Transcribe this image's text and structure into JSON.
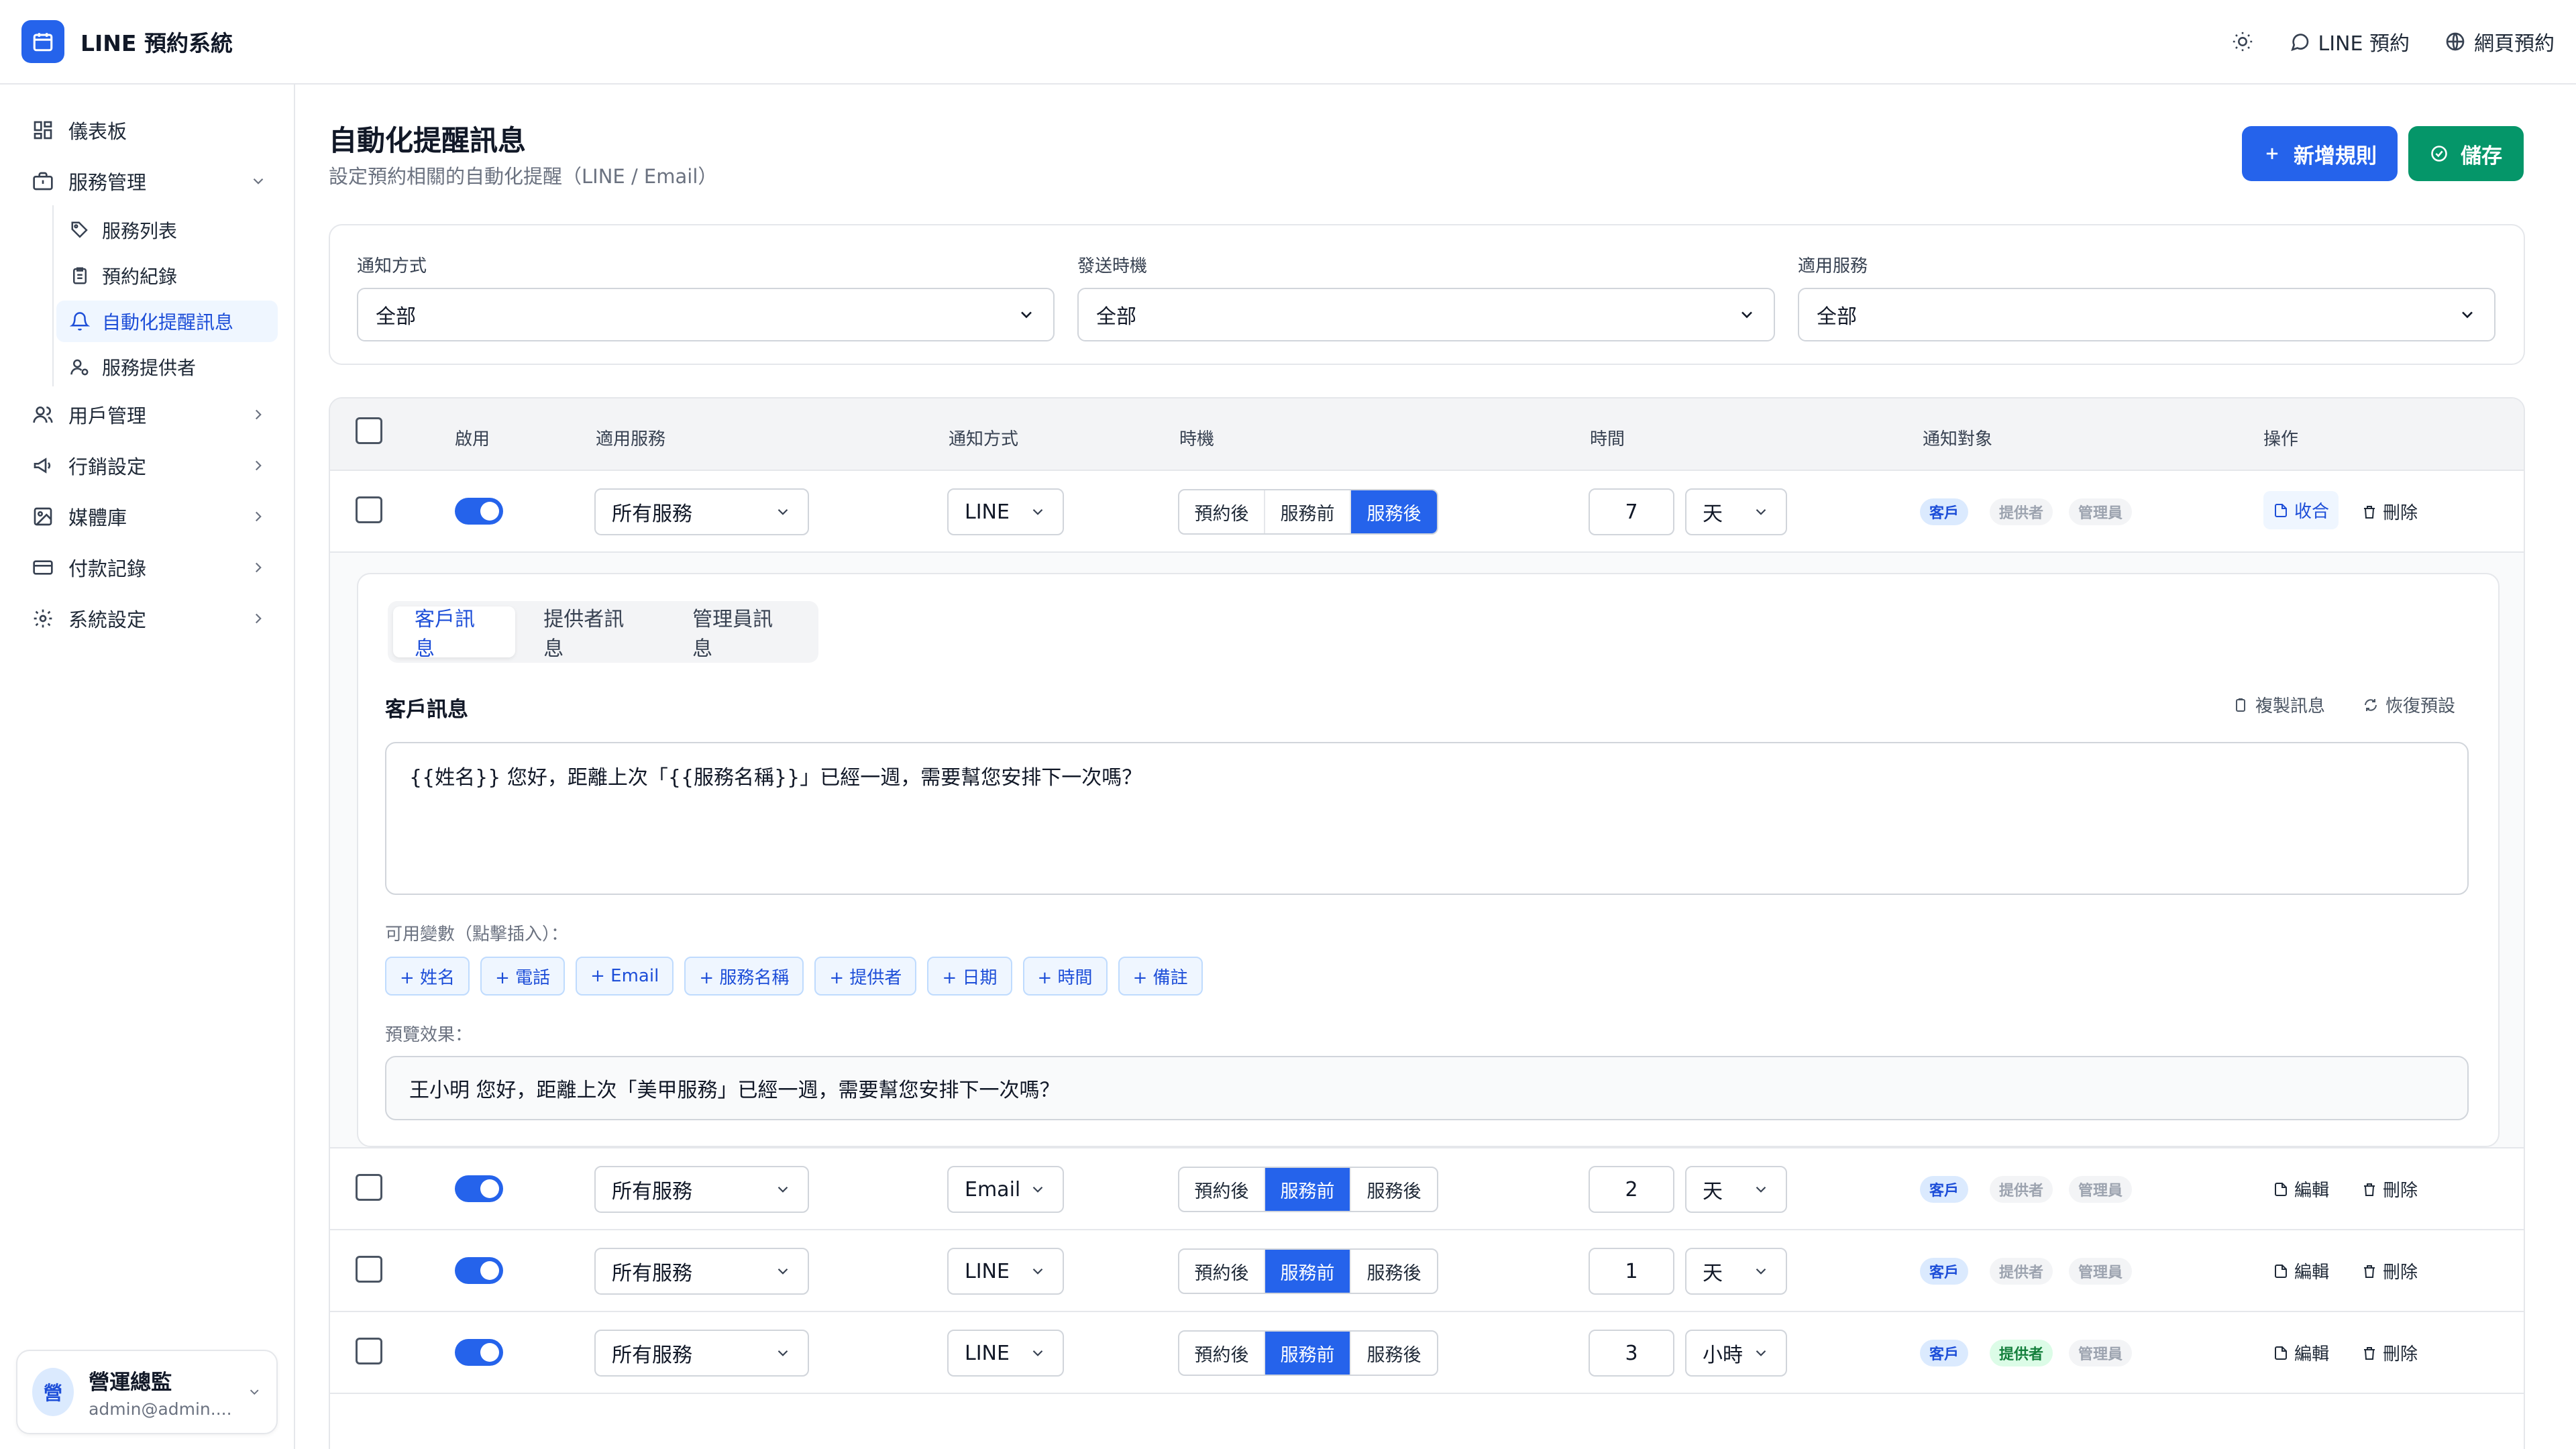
{
  "app": {
    "title": "LINE 預約系統"
  },
  "topbar": {
    "theme_icon": "sun-icon",
    "line_link": "LINE 預約",
    "web_link": "網頁預約"
  },
  "sidebar": {
    "dashboard": "儀表板",
    "service_mgmt": "服務管理",
    "sub": [
      "服務列表",
      "預約紀錄",
      "自動化提醒訊息",
      "服務提供者"
    ],
    "user_mgmt": "用戶管理",
    "marketing": "行銷設定",
    "media": "媒體庫",
    "payments": "付款記錄",
    "settings": "系統設定",
    "user": {
      "initial": "營",
      "name": "營運總監",
      "email": "admin@admin...."
    }
  },
  "page": {
    "title": "自動化提醒訊息",
    "subtitle": "設定預約相關的自動化提醒（LINE / Email）",
    "add_button": "新增規則",
    "save_button": "儲存"
  },
  "filters": {
    "method": {
      "label": "通知方式",
      "value": "全部"
    },
    "timing": {
      "label": "發送時機",
      "value": "全部"
    },
    "service": {
      "label": "適用服務",
      "value": "全部"
    }
  },
  "table": {
    "headers": {
      "enabled": "啟用",
      "service": "適用服務",
      "method": "通知方式",
      "timing": "時機",
      "time": "時間",
      "target": "通知對象",
      "actions": "操作"
    },
    "timing_options": [
      "預約後",
      "服務前",
      "服務後"
    ],
    "target_labels": [
      "客戶",
      "提供者",
      "管理員"
    ],
    "rows": [
      {
        "service": "所有服務",
        "method": "LINE",
        "timing": 2,
        "amount": "7",
        "unit": "天",
        "targets": [
          "on",
          "off",
          "off"
        ],
        "action": "收合",
        "delete": "刪除"
      },
      {
        "service": "所有服務",
        "method": "Email",
        "timing": 1,
        "amount": "2",
        "unit": "天",
        "targets": [
          "on",
          "off",
          "off"
        ],
        "action": "編輯",
        "delete": "刪除"
      },
      {
        "service": "所有服務",
        "method": "LINE",
        "timing": 1,
        "amount": "1",
        "unit": "天",
        "targets": [
          "on",
          "off",
          "off"
        ],
        "action": "編輯",
        "delete": "刪除"
      },
      {
        "service": "所有服務",
        "method": "LINE",
        "timing": 1,
        "amount": "3",
        "unit": "小時",
        "targets": [
          "on",
          "green",
          "off"
        ],
        "action": "編輯",
        "delete": "刪除"
      }
    ]
  },
  "editor": {
    "tabs": [
      "客戶訊息",
      "提供者訊息",
      "管理員訊息"
    ],
    "section_title": "客戶訊息",
    "copy": "複製訊息",
    "reset": "恢復預設",
    "message": "{{姓名}} 您好，距離上次「{{服務名稱}}」已經一週，需要幫您安排下一次嗎？",
    "variables_label": "可用變數（點擊插入）：",
    "variables": [
      "+ 姓名",
      "+ 電話",
      "+ Email",
      "+ 服務名稱",
      "+ 提供者",
      "+ 日期",
      "+ 時間",
      "+ 備註"
    ],
    "preview_label": "預覽效果：",
    "preview": "王小明 您好，距離上次「美甲服務」已經一週，需要幫您安排下一次嗎？"
  }
}
